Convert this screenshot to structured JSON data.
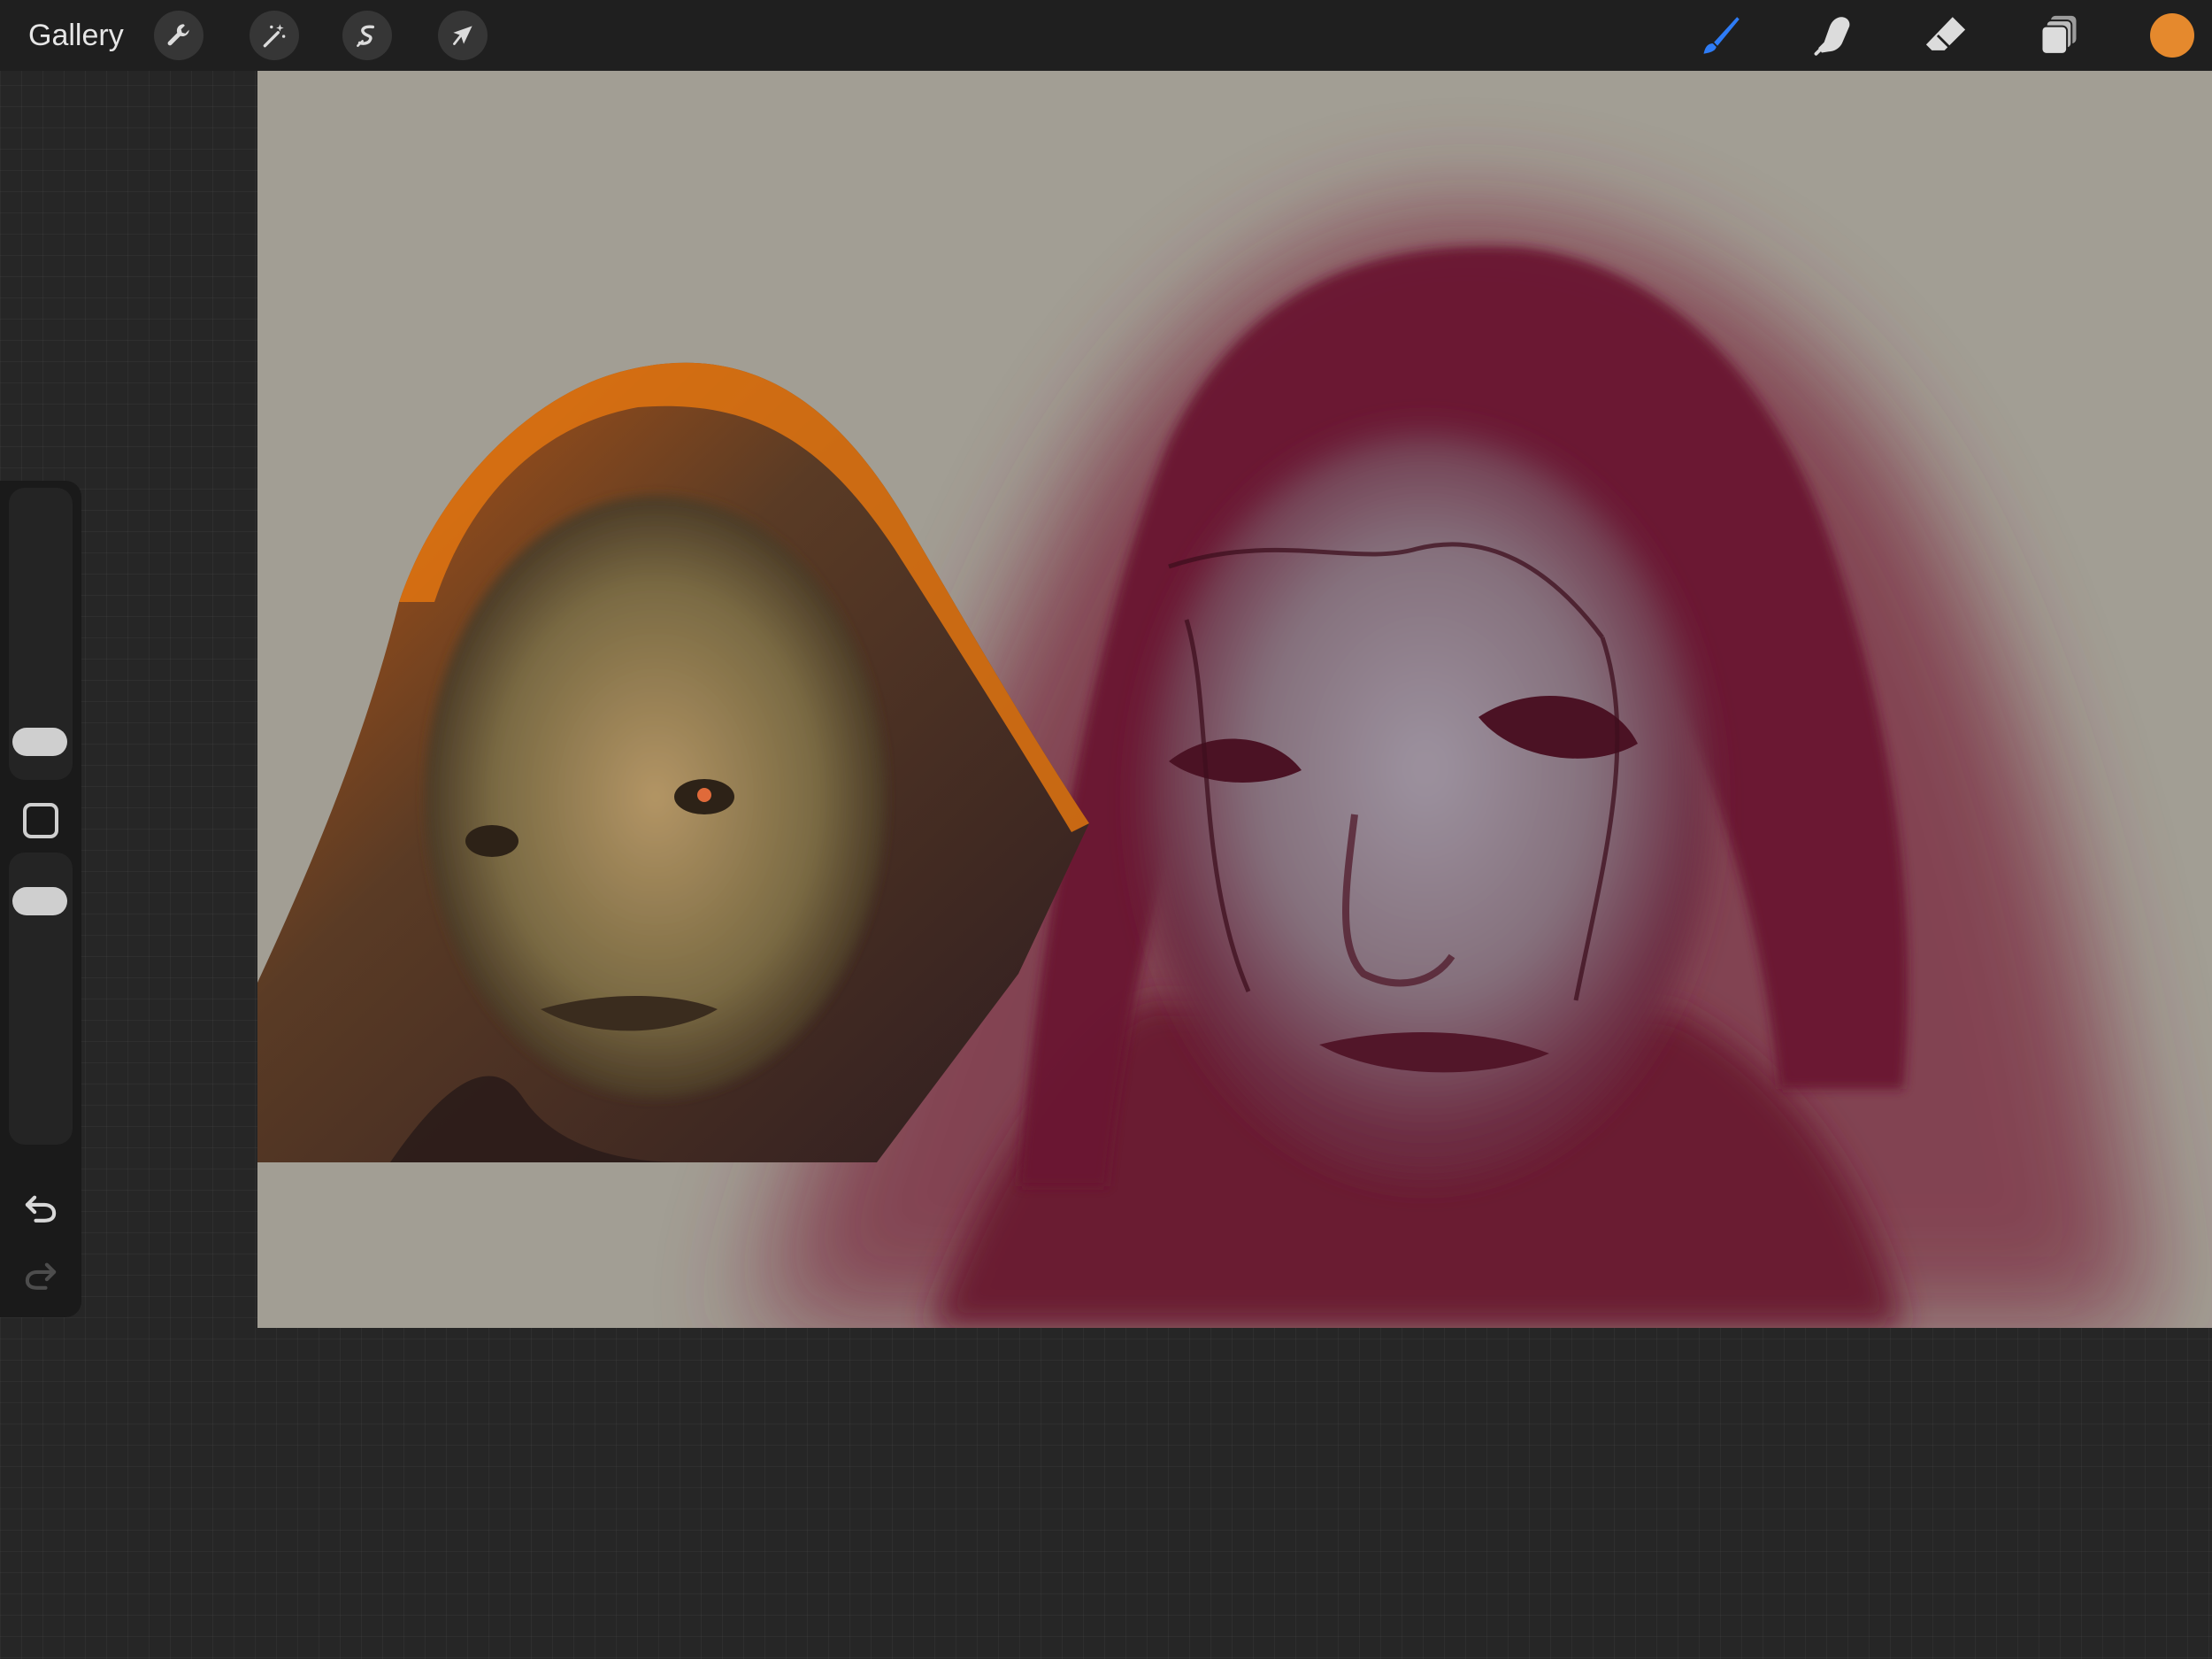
{
  "toolbar": {
    "gallery_label": "Gallery",
    "left_tools": [
      {
        "name": "actions",
        "icon": "wrench-icon"
      },
      {
        "name": "adjustments",
        "icon": "magic-wand-icon"
      },
      {
        "name": "selection",
        "icon": "selection-s-icon"
      },
      {
        "name": "transform",
        "icon": "arrow-cursor-icon"
      }
    ],
    "right_tools": [
      {
        "name": "brush",
        "icon": "brush-icon",
        "active": true
      },
      {
        "name": "smudge",
        "icon": "smudge-finger-icon",
        "active": false
      },
      {
        "name": "eraser",
        "icon": "eraser-icon",
        "active": false
      },
      {
        "name": "layers",
        "icon": "layers-icon",
        "active": false
      }
    ],
    "current_color": "#e5892d",
    "active_tool_color": "#2e7cf6"
  },
  "sidebar": {
    "brush_size_slider": {
      "icon": "size-slider"
    },
    "modifier_button": {
      "icon": "square-icon"
    },
    "opacity_slider": {
      "icon": "opacity-slider"
    },
    "undo": {
      "icon": "undo-icon"
    },
    "redo": {
      "icon": "redo-icon",
      "enabled": false
    }
  },
  "canvas": {
    "paper_color": "#a29e94",
    "sketch_tone": "#7a2a40",
    "reference_photo_tone": "#6b5a38"
  }
}
